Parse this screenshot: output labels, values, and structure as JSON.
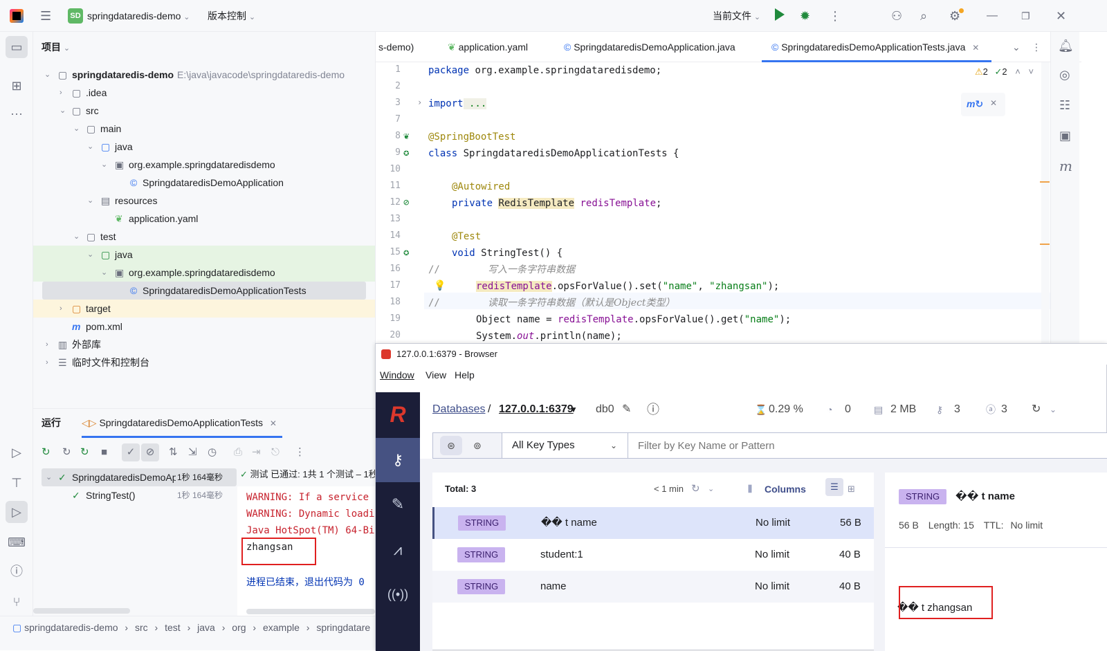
{
  "titlebar": {
    "project_badge": "SD",
    "project_name": "springdataredis-demo",
    "vcs": "版本控制",
    "current_file": "当前文件"
  },
  "project_panel": {
    "header": "项目",
    "tree": [
      {
        "label": "springdataredis-demo",
        "path": "E:\\java\\javacode\\springdataredis-demo"
      },
      {
        "label": ".idea"
      },
      {
        "label": "src"
      },
      {
        "label": "main"
      },
      {
        "label": "java"
      },
      {
        "label": "org.example.springdataredisdemo"
      },
      {
        "label": "SpringdataredisDemoApplication"
      },
      {
        "label": "resources"
      },
      {
        "label": "application.yaml"
      },
      {
        "label": "test"
      },
      {
        "label": "java"
      },
      {
        "label": "org.example.springdataredisdemo"
      },
      {
        "label": "SpringdataredisDemoApplicationTests"
      },
      {
        "label": "target"
      },
      {
        "label": "pom.xml"
      },
      {
        "label": "外部库"
      },
      {
        "label": "临时文件和控制台"
      }
    ]
  },
  "editor": {
    "tabs": [
      {
        "label": "s-demo)"
      },
      {
        "label": "application.yaml"
      },
      {
        "label": "SpringdataredisDemoApplication.java"
      },
      {
        "label": "SpringdataredisDemoApplicationTests.java"
      }
    ],
    "warnings": "2",
    "checks": "2",
    "line_numbers": [
      "1",
      "2",
      "3",
      "7",
      "8",
      "9",
      "10",
      "11",
      "12",
      "13",
      "14",
      "15",
      "16",
      "17",
      "18",
      "19",
      "20"
    ],
    "code": {
      "l1_kw": "package",
      "l1_rest": " org.example.springdataredisdemo;",
      "l3_kw": "import",
      "l3_rest": " ...",
      "l8": "@SpringBootTest",
      "l9_kw": "class",
      "l9_rest": " SpringdataredisDemoApplicationTests {",
      "l11": "@Autowired",
      "l12_kw": "private",
      "l12_type": "RedisTemplate",
      "l12_field": "redisTemplate",
      "l12_end": ";",
      "l14": "@Test",
      "l15_kw": "void",
      "l15_rest": " StringTest() {",
      "l16_prefix": "//",
      "l16_comment": "写入一条字符串数据",
      "l17_field": "redisTemplate",
      "l17_mid": ".opsForValue().set(",
      "l17_s1": "\"name\"",
      "l17_comma": ", ",
      "l17_s2": "\"zhangsan\"",
      "l17_end": ");",
      "l18_prefix": "//",
      "l18_comment": "读取一条字符串数据（默认是Object类型）",
      "l19_a": "Object name = ",
      "l19_field": "redisTemplate",
      "l19_mid": ".opsForValue().get(",
      "l19_s": "\"name\"",
      "l19_end": ");",
      "l20_a": "System.",
      "l20_out": "out",
      "l20_b": ".println(name);"
    }
  },
  "run_panel": {
    "title": "运行",
    "tab": "SpringdataredisDemoApplicationTests",
    "test_root": "SpringdataredisDemoAp",
    "test_root_time": "1秒 164毫秒",
    "test_child": "StringTest()",
    "test_child_time": "1秒 164毫秒",
    "status": "测试 已通过: 1共 1 个测试 – 1秒",
    "console": [
      "WARNING: If a service",
      "WARNING: Dynamic loadi",
      "Java HotSpot(TM) 64-Bi",
      "zhangsan",
      "进程已结束，退出代码为 0"
    ]
  },
  "statusbar": {
    "breadcrumb": [
      "springdataredis-demo",
      "src",
      "test",
      "java",
      "org",
      "example",
      "springdatare"
    ]
  },
  "browser": {
    "window_title": "127.0.0.1:6379 - Browser",
    "menu": [
      "Window",
      "View",
      "Help"
    ],
    "breadcrumb_databases": "Databases",
    "breadcrumb_sep": "/",
    "host": "127.0.0.1:6379",
    "db": "db0",
    "stats": {
      "cpu": "0.29 %",
      "ops": "0",
      "memory": "2 MB",
      "keys": "3",
      "clients": "3"
    },
    "filter": {
      "key_type": "All Key Types",
      "placeholder": "Filter by Key Name or Pattern"
    },
    "list": {
      "total": "Total: 3",
      "refresh": "< 1 min",
      "columns": "Columns",
      "rows": [
        {
          "type": "STRING",
          "key": "�� t name",
          "ttl": "No limit",
          "size": "56 B"
        },
        {
          "type": "STRING",
          "key": "student:1",
          "ttl": "No limit",
          "size": "40 B"
        },
        {
          "type": "STRING",
          "key": "name",
          "ttl": "No limit",
          "size": "40 B"
        }
      ]
    },
    "detail": {
      "type": "STRING",
      "key": "�� t name",
      "size": "56 B",
      "length": "Length: 15",
      "ttl_label": "TTL:",
      "ttl": "No limit",
      "value": "�� t zhangsan"
    }
  },
  "colors": {
    "accent": "#3574f0",
    "redis_red": "#dc382c",
    "badge": "#c9b3ef",
    "sidebar_dark": "#1b1e38",
    "highlight_box": "#e02020"
  }
}
